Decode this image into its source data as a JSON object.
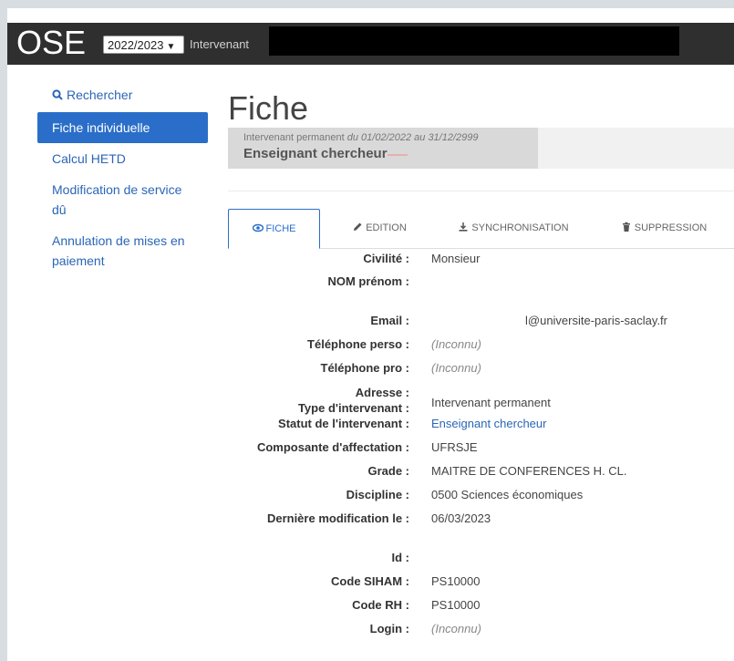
{
  "topbar": {
    "logo": "OSE",
    "year": "2022/2023",
    "role": "Intervenant"
  },
  "sidebar": {
    "items": [
      {
        "label": "Rechercher",
        "icon": "search-icon"
      },
      {
        "label": "Fiche individuelle"
      },
      {
        "label": "Calcul HETD"
      },
      {
        "label": "Modification de service dû"
      },
      {
        "label": "Annulation de mises en paiement"
      }
    ]
  },
  "main": {
    "title": "Fiche",
    "status": {
      "type_label": "Intervenant permanent",
      "period": "du 01/02/2022 au 31/12/2999",
      "statut": "Enseignant chercheur"
    },
    "tabs": [
      {
        "label": "FICHE",
        "icon": "eye-icon"
      },
      {
        "label": "EDITION",
        "icon": "pencil-icon"
      },
      {
        "label": "SYNCHRONISATION",
        "icon": "download-icon"
      },
      {
        "label": "SUPPRESSION",
        "icon": "trash-icon"
      }
    ],
    "fields": {
      "civilite": {
        "label": "Civilité :",
        "value": "Monsieur"
      },
      "nom": {
        "label": "NOM prénom :",
        "value": ""
      },
      "email": {
        "label": "Email :",
        "value": "l@universite-paris-saclay.fr"
      },
      "tel_perso": {
        "label": "Téléphone perso :",
        "value": "(Inconnu)"
      },
      "tel_pro": {
        "label": "Téléphone pro :",
        "value": "(Inconnu)"
      },
      "adresse": {
        "label": "Adresse :",
        "value": ""
      },
      "type": {
        "label": "Type d'intervenant :",
        "value": "Intervenant permanent"
      },
      "statut": {
        "label": "Statut de l'intervenant :",
        "value": "Enseignant chercheur"
      },
      "composante": {
        "label": "Composante d'affectation :",
        "value": "UFRSJE"
      },
      "grade": {
        "label": "Grade :",
        "value": "MAITRE DE CONFERENCES H. CL."
      },
      "discipline": {
        "label": "Discipline :",
        "value": "0500 Sciences économiques"
      },
      "derniere_modif": {
        "label": "Dernière modification le :",
        "value": "06/03/2023"
      },
      "id": {
        "label": "Id :",
        "value": ""
      },
      "code_siham": {
        "label": "Code SIHAM :",
        "value": "PS10000"
      },
      "code_rh": {
        "label": "Code RH :",
        "value": "PS10000"
      },
      "login": {
        "label": "Login :",
        "value": "(Inconnu)"
      }
    }
  },
  "colors": {
    "accent": "#2a6ec9",
    "link": "#2a66b6",
    "topbar": "#2f2f30"
  }
}
